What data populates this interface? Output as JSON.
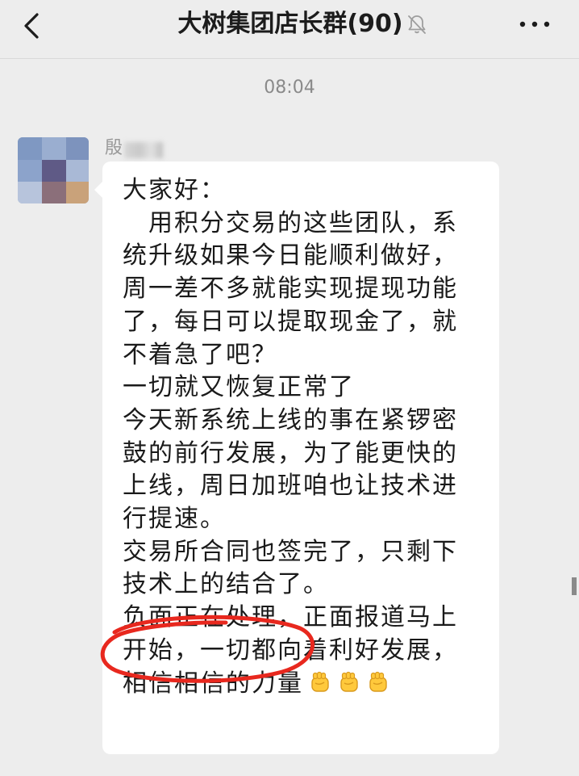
{
  "header": {
    "title": "大树集团店长群(90)",
    "back_icon": "chevron-left-icon",
    "mute_icon": "bell-muted-icon",
    "more_icon": "more-horizontal-icon"
  },
  "chat": {
    "timestamp": "08:04",
    "message": {
      "sender_name": "殷",
      "lines": [
        "大家好：",
        "　用积分交易的这些团队，系",
        "统升级如果今日能顺利做好，",
        "周一差不多就能实现提现功能",
        "了，每日可以提取现金了，就",
        "不着急了吧？",
        "一切就又恢复正常了",
        "今天新系统上线的事在紧锣密",
        "鼓的前行发展，为了能更快的",
        "上线，周日加班咱也让技术进",
        "行提速。",
        "交易所合同也签完了，只剩下",
        "技术上的结合了。",
        "负面正在处理，正面报道马上",
        "开始，一切都向着利好发展，",
        "相信相信的力量"
      ],
      "trailing_emoji": [
        "fist-emoji",
        "fist-emoji",
        "fist-emoji"
      ]
    }
  },
  "colors": {
    "background": "#ededed",
    "bubble": "#ffffff",
    "annotation_red": "#e8281e",
    "timestamp": "#8a8a8a"
  }
}
